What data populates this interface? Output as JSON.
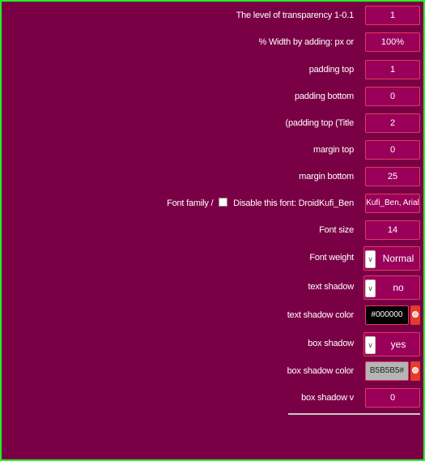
{
  "settings": {
    "transparency": {
      "label": "The level of transparency 1-0.1",
      "value": "1"
    },
    "width": {
      "label": "% Width by adding: px or",
      "value": "100%"
    },
    "padding_top": {
      "label": "padding top",
      "value": "1"
    },
    "padding_bottom": {
      "label": "padding bottom",
      "value": "0"
    },
    "padding_top_title": {
      "label": "(padding top (Title",
      "value": "2"
    },
    "margin_top": {
      "label": "margin top",
      "value": "0"
    },
    "margin_bottom": {
      "label": "margin bottom",
      "value": "25"
    },
    "font_family": {
      "label": "Font family /",
      "disable_label": "Disable this font: DroidKufi_Ben",
      "value": "Kufi_Ben, Arial"
    },
    "font_size": {
      "label": "Font size",
      "value": "14"
    },
    "font_weight": {
      "label": "Font weight",
      "value": "Normal"
    },
    "text_shadow": {
      "label": "text shadow",
      "value": "no"
    },
    "text_shadow_color": {
      "label": "text shadow color",
      "value": "#000000",
      "swatch": "#000000"
    },
    "box_shadow": {
      "label": "box shadow",
      "value": "yes"
    },
    "box_shadow_color": {
      "label": "box shadow color",
      "value": "B5B5B5#",
      "swatch": "#b5b5b5"
    },
    "box_shadow_v": {
      "label": "box shadow v",
      "value": "0"
    }
  },
  "colors": {
    "background": "#7a0046",
    "field": "#9a0059",
    "field_border": "#e03b5e",
    "frame": "#23f023"
  },
  "icons": {
    "select_arrow": "chevron-down-icon",
    "color_picker": "color-picker-icon"
  }
}
